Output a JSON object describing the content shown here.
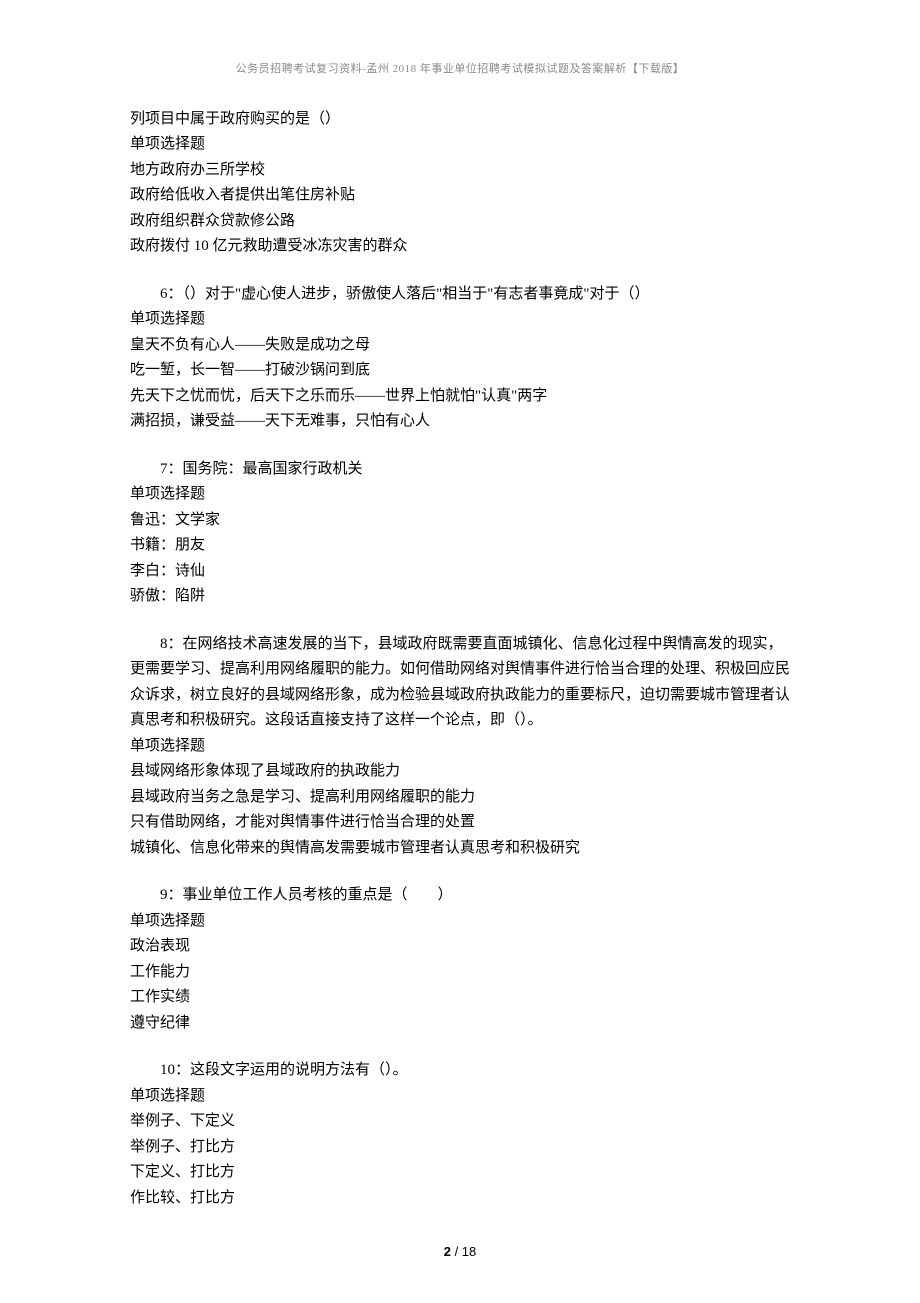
{
  "header": "公务员招聘考试复习资料-孟州 2018 年事业单位招聘考试模拟试题及答案解析【下载版】",
  "q5": {
    "continuation": "列项目中属于政府购买的是（）",
    "type": "单项选择题",
    "opts": [
      "地方政府办三所学校",
      "政府给低收入者提供出笔住房补贴",
      "政府组织群众贷款修公路",
      "政府拨付 10 亿元救助遭受冰冻灾害的群众"
    ]
  },
  "q6": {
    "stem": "6：（）对于\"虚心使人进步，骄傲使人落后\"相当于\"有志者事竟成\"对于（）",
    "type": "单项选择题",
    "opts": [
      "皇天不负有心人——失败是成功之母",
      "吃一堑，长一智——打破沙锅问到底",
      "先天下之忧而忧，后天下之乐而乐——世界上怕就怕\"认真\"两字",
      "满招损，谦受益——天下无难事，只怕有心人"
    ]
  },
  "q7": {
    "stem": "7：国务院：最高国家行政机关",
    "type": "单项选择题",
    "opts": [
      "鲁迅：文学家",
      "书籍：朋友",
      "李白：诗仙",
      "骄傲：陷阱"
    ]
  },
  "q8": {
    "stem": "8：在网络技术高速发展的当下，县域政府既需要直面城镇化、信息化过程中舆情高发的现实，更需要学习、提高利用网络履职的能力。如何借助网络对舆情事件进行恰当合理的处理、积极回应民众诉求，树立良好的县域网络形象，成为检验县域政府执政能力的重要标尺，迫切需要城市管理者认真思考和积极研究。这段话直接支持了这样一个论点，即（）。",
    "type": "单项选择题",
    "opts": [
      "县域网络形象体现了县域政府的执政能力",
      "县域政府当务之急是学习、提高利用网络履职的能力",
      "只有借助网络，才能对舆情事件进行恰当合理的处置",
      "城镇化、信息化带来的舆情高发需要城市管理者认真思考和积极研究"
    ]
  },
  "q9": {
    "stem": "9：事业单位工作人员考核的重点是（　　）",
    "type": "单项选择题",
    "opts": [
      "政治表现",
      "工作能力",
      "工作实绩",
      "遵守纪律"
    ]
  },
  "q10": {
    "stem": "10：这段文字运用的说明方法有（）。",
    "type": "单项选择题",
    "opts": [
      "举例子、下定义",
      "举例子、打比方",
      "下定义、打比方",
      "作比较、打比方"
    ]
  },
  "footer": {
    "current": "2",
    "sep": " / ",
    "total": "18"
  }
}
